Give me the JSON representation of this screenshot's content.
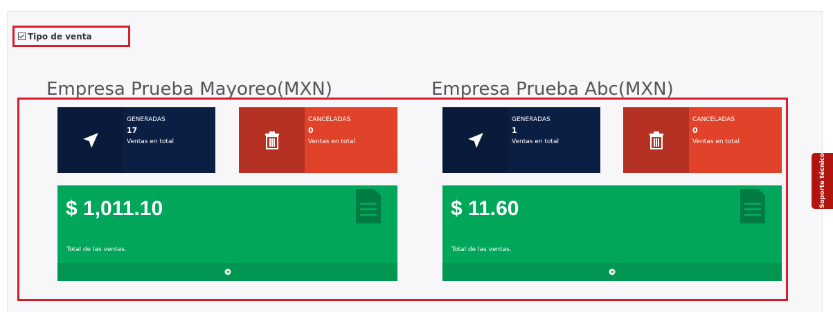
{
  "section": {
    "label": "Tipo de venta"
  },
  "companies": [
    {
      "title": "Empresa Prueba Mayoreo(MXN)",
      "generated": {
        "label": "GENERADAS",
        "count": "17",
        "sub": "Ventas en total"
      },
      "cancelled": {
        "label": "CANCELADAS",
        "count": "0",
        "sub": "Ventas en total"
      },
      "total": {
        "amount": "$ 1,011.10",
        "caption": "Total de las ventas."
      }
    },
    {
      "title": "Empresa Prueba Abc(MXN)",
      "generated": {
        "label": "GENERADAS",
        "count": "1",
        "sub": "Ventas en total"
      },
      "cancelled": {
        "label": "CANCELADAS",
        "count": "0",
        "sub": "Ventas en total"
      },
      "total": {
        "amount": "$ 11.60",
        "caption": "Total de las ventas."
      }
    }
  ],
  "support_tab": {
    "label": "Soporte técnico"
  },
  "icons": {
    "generated": "paper-plane-icon",
    "cancelled": "trash-icon",
    "card_footer": "arrow-circle-right-icon",
    "card_background": "file-text-icon"
  },
  "colors": {
    "navy": "#0b1f44",
    "red": "#e0432a",
    "green": "#00a65a",
    "highlight": "#d71d2b",
    "support": "#b1150f"
  }
}
